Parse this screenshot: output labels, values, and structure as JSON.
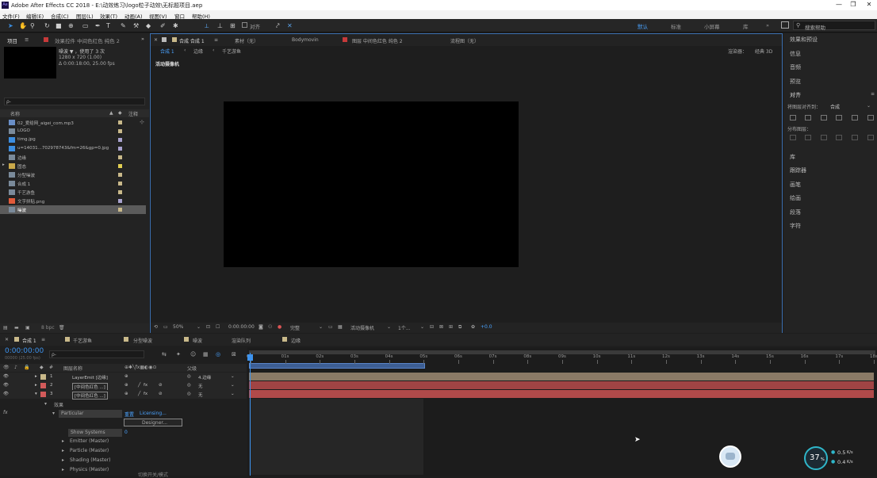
{
  "app": {
    "title": "Adobe After Effects CC 2018 - E:\\动效练习\\logo粒子动效\\无标题项目.aep",
    "logo": "Ae"
  },
  "window": {
    "min": "—",
    "max": "❐",
    "close": "✕"
  },
  "menu": [
    "文件(F)",
    "编辑(E)",
    "合成(C)",
    "图层(L)",
    "效果(T)",
    "动画(A)",
    "视图(V)",
    "窗口",
    "帮助(H)"
  ],
  "toolbar": {
    "align_label": "对齐",
    "workspaces": [
      "默认",
      "标准",
      "小屏幕",
      "库"
    ],
    "search_placeholder": "搜索帮助"
  },
  "project": {
    "tab": "项目",
    "effects_tab": "效果控件 中间色红色 纯色 2",
    "preview_name": "噪波 ▼ ，使用了 3 次",
    "preview_size": "1280 x 720 (1.00)",
    "preview_time": "Δ 0:00:18:00, 25.00 fps",
    "search_placeholder": "ρ-",
    "col_name": "名称",
    "col_note": "注释",
    "bpc": "8 bpc",
    "items": [
      {
        "name": "02_爱给网_aigei_com.mp3",
        "type": "audio",
        "color": "#c9b98a"
      },
      {
        "name": "LOGO",
        "type": "comp",
        "color": "#c9b98a"
      },
      {
        "name": "timg.jpg",
        "type": "image",
        "color": "#a9a3cf"
      },
      {
        "name": "u=14031...702978743&fm=26&gp=0.jpg",
        "type": "image",
        "color": "#a9a3cf"
      },
      {
        "name": "边缘",
        "type": "comp",
        "color": "#c9b98a"
      },
      {
        "name": "固态",
        "type": "folder",
        "color": "#e2cf52"
      },
      {
        "name": "分型噪波",
        "type": "comp",
        "color": "#c9b98a"
      },
      {
        "name": "合成 1",
        "type": "comp",
        "color": "#c9b98a"
      },
      {
        "name": "千艺游鱼",
        "type": "comp",
        "color": "#c9b98a"
      },
      {
        "name": "文字拼贴.png",
        "type": "png",
        "color": "#a9a3cf"
      },
      {
        "name": "噪波",
        "type": "comp",
        "color": "#c9b98a",
        "selected": true
      }
    ]
  },
  "comp": {
    "tab": "合成 合成 1",
    "tabs_other": [
      "素材（无）",
      "Bodymovin",
      "图层 中间色红色 纯色 2",
      "流程图（无）"
    ],
    "breadcrumbs": [
      "合成 1",
      "边缘",
      "千艺游鱼"
    ],
    "renderer": "渲染器：",
    "renderer_value": "经典 3D",
    "camera_label": "活动摄像机",
    "zoom": "50%",
    "timecode": "0:00:00:00",
    "quality": "完整",
    "view": "活动摄像机",
    "views": "1个...",
    "exposure": "+0.0"
  },
  "right": {
    "items": [
      "效果和预设",
      "信息",
      "音频",
      "预览",
      "对齐",
      "库",
      "跟踪器",
      "画笔",
      "绘画",
      "段落",
      "字符"
    ],
    "align_to_label": "将图层对齐到：",
    "align_to_value": "合成",
    "distribute_label": "分布图层："
  },
  "timeline": {
    "tabs": [
      "合成 1",
      "千艺游鱼",
      "分型噪波",
      "噪波",
      "渲染队列",
      "边缘"
    ],
    "timecode": "0:00:00:00",
    "fps": "00000 (25.00 fps)",
    "search_placeholder": "ρ-",
    "col_layer": "图层名称",
    "col_parent": "父级",
    "layers": [
      {
        "num": "1",
        "name": "LayerEmit [边缘]",
        "parent": "4.边缘",
        "color": "#c9b98a",
        "bar": "#8a7a66"
      },
      {
        "num": "2",
        "name": "[中间色红色 ...]",
        "parent": "无",
        "color": "#d25a5a",
        "bar": "#a04444"
      },
      {
        "num": "3",
        "name": "[中间色红色 ...]",
        "parent": "无",
        "color": "#d25a5a",
        "bar": "#a04444"
      }
    ],
    "effects_label": "效果",
    "particular": "Particular",
    "reset": "重置",
    "licensing": "Licensing...",
    "designer": "Designer...",
    "show_systems": "Show Systems",
    "show_systems_val": "0",
    "groups": [
      "Emitter (Master)",
      "Particle (Master)",
      "Shading (Master)",
      "Physics (Master)"
    ],
    "ruler": [
      "0s",
      "01s",
      "02s",
      "03s",
      "04s",
      "05s",
      "06s",
      "07s",
      "08s",
      "09s",
      "10s",
      "11s",
      "12s",
      "13s",
      "14s",
      "15s",
      "16s",
      "17s",
      "18s"
    ],
    "switch_label": "切换开关/模式"
  },
  "status": {
    "cpu": "37",
    "cpu_unit": "%",
    "up": "0.5",
    "up_unit": "K/s",
    "down": "0.4",
    "down_unit": "K/s"
  }
}
